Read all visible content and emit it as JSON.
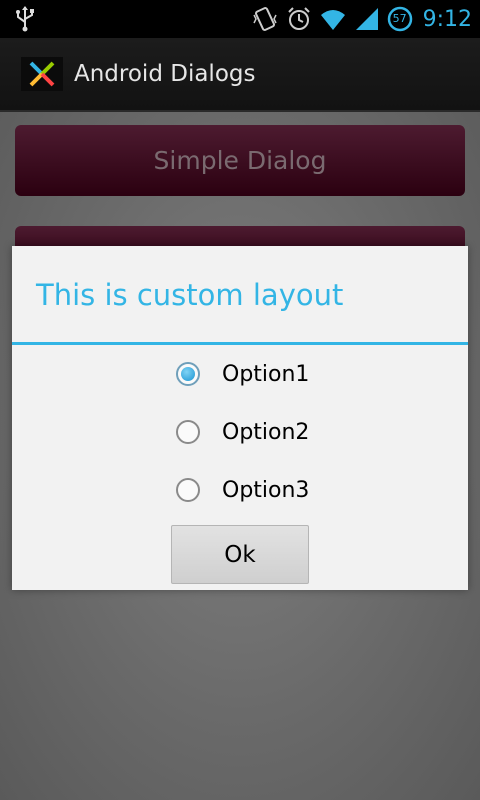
{
  "status_bar": {
    "battery_level": "57",
    "time": "9:12",
    "icons": [
      "usb-icon",
      "vibrate-icon",
      "alarm-icon",
      "wifi-icon",
      "signal-icon",
      "battery-icon"
    ]
  },
  "action_bar": {
    "title": "Android Dialogs",
    "app_icon": "x-logo-icon"
  },
  "main": {
    "buttons": [
      {
        "label": "Simple Dialog"
      },
      {
        "label": ""
      }
    ]
  },
  "dialog": {
    "title": "This is custom layout",
    "options": [
      {
        "label": "Option1",
        "checked": true
      },
      {
        "label": "Option2",
        "checked": false
      },
      {
        "label": "Option3",
        "checked": false
      }
    ],
    "ok_label": "Ok"
  },
  "colors": {
    "accent": "#33b5e5",
    "button_gradient_top": "#4d1b30",
    "button_gradient_bottom": "#2b0010",
    "dialog_bg": "#f2f2f2"
  }
}
